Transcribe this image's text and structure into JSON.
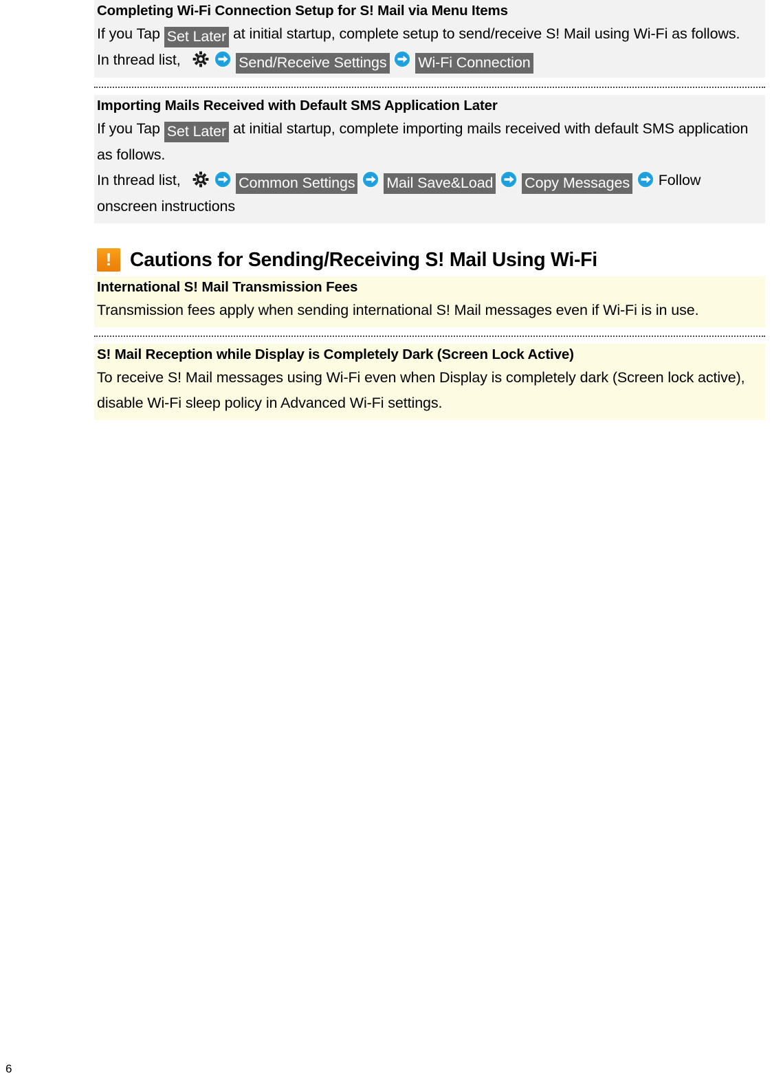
{
  "page": {
    "number": "6"
  },
  "sections": [
    {
      "id": "wifi-setup",
      "style": "gray",
      "title": "Completing Wi-Fi Connection Setup for S! Mail via Menu Items",
      "body_lead": "If you Tap",
      "chip_set_later": "Set Later",
      "body_mid": "at initial startup, complete setup to send/receive S! Mail using Wi-Fi as follows.",
      "path_lead": "In thread list,",
      "path_items": [
        "Send/Receive Settings",
        "Wi-Fi Connection"
      ],
      "path_trail": ""
    },
    {
      "id": "importing-mails",
      "style": "gray",
      "title": "Importing Mails Received with Default SMS Application Later",
      "body_lead": "If you Tap",
      "chip_set_later": "Set Later",
      "body_mid": "at initial startup, complete importing mails received with default SMS application as follows.",
      "path_lead": "In thread list,",
      "path_items": [
        "Common Settings",
        "Mail Save&Load",
        "Copy Messages"
      ],
      "path_trail": "Follow onscreen instructions"
    }
  ],
  "cautions": {
    "heading": "Cautions for Sending/Receiving S! Mail Using Wi-Fi",
    "icon": "warning-icon",
    "icon_glyph": "!",
    "items": [
      {
        "id": "international-fees",
        "title": "International S! Mail Transmission Fees",
        "body": "Transmission fees apply when sending international S! Mail messages even if Wi-Fi is in use."
      },
      {
        "id": "dark-display-reception",
        "title": "S! Mail Reception while Display is Completely Dark (Screen Lock Active)",
        "body": "To receive S! Mail messages using Wi-Fi even when Display is completely dark (Screen lock active), disable Wi-Fi sleep policy in Advanced Wi-Fi settings."
      }
    ]
  },
  "icons": {
    "gear": "gear-icon",
    "arrow": "blue-arrow-right-icon"
  },
  "colors": {
    "gray_block_bg": "#f2f2f2",
    "cream_block_bg": "#fdfbe1",
    "chip_bg": "#696969",
    "chip_text": "#ffffff",
    "warning_orange": "#f0900f",
    "arrow_blue": "#1f9ede"
  }
}
